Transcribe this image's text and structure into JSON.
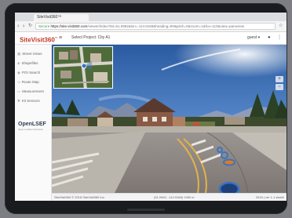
{
  "browser": {
    "tab_title": "SiteVisit360™",
    "url_secure_label": "Secure",
    "url_host": "https://site.visit360.com",
    "url_path": "/viewer/index?lat=51.0962&lon=-114.9168&heading=90&pitch=0&zoom=1&fov=110&view=panoview",
    "nav_back_icon": "back-arrow-icon",
    "nav_forward_icon": "forward-arrow-icon",
    "nav_reload_icon": "reload-icon"
  },
  "app": {
    "logo_text": "SiteVisit360",
    "logo_tm": "™",
    "menu_icon": "hamburger-icon",
    "project_label": "Select Project: City A1",
    "user_label": "guest ▾",
    "header_icons": [
      "person-icon",
      "menu-dots-icon"
    ],
    "sidebar": [
      {
        "icon": "grid-icon",
        "label": "Street Views"
      },
      {
        "icon": "layers-icon",
        "label": "Shapefiles"
      },
      {
        "icon": "pin-icon",
        "label": "POI Search"
      },
      {
        "icon": "route-icon",
        "label": "Route Map"
      },
      {
        "icon": "ruler-icon",
        "label": "Measurement"
      },
      {
        "icon": "gear-icon",
        "label": "Kit Sensors"
      }
    ],
    "partner_logo": "OpenLSEF",
    "partner_sub": "Open Location Services",
    "status": {
      "left": "SiteVisit360 © 2018 SiteVisit360 Inc.",
      "middle": "(51.0962, -114.9168) 1380 m",
      "right": "2018 | ver 1.1 stable"
    }
  },
  "colors": {
    "brand_red": "#c0392b",
    "tablet_bezel": "#1a1b1e",
    "sky_top": "#2a5aa0",
    "road": "#8f8a86",
    "marker_blue": "#3b73c4",
    "marker_orange": "#e07a22"
  }
}
